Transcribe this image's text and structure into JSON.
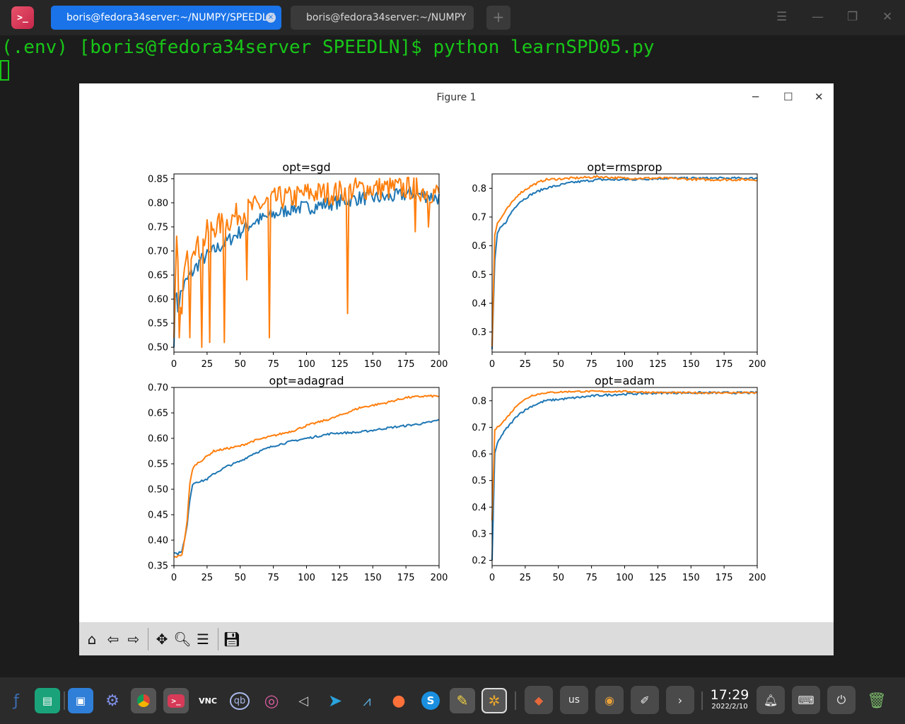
{
  "terminal": {
    "tabs": [
      {
        "label": "boris@fedora34server:~/NUMPY/SPEEDLN",
        "active": true
      },
      {
        "label": "boris@fedora34server:~/NUMPY",
        "active": false
      }
    ],
    "new_tab": "+",
    "command_line": "(.env) [boris@fedora34server SPEEDLN]$ python learnSPD05.py",
    "text_color": "#18c618"
  },
  "figure": {
    "title": "Figure 1",
    "toolbar": [
      "home-icon",
      "back-icon",
      "forward-icon",
      "pan-icon",
      "zoom-icon",
      "configure-icon",
      "save-icon"
    ]
  },
  "chart_data": [
    {
      "type": "line",
      "title": "opt=sgd",
      "xlim": [
        0,
        200
      ],
      "ylim": [
        0.49,
        0.86
      ],
      "xticks": [
        "0",
        "25",
        "50",
        "75",
        "100",
        "125",
        "150",
        "175",
        "200"
      ],
      "yticks": [
        "0.50",
        "0.55",
        "0.60",
        "0.65",
        "0.70",
        "0.75",
        "0.80",
        "0.85"
      ],
      "ytick_values": [
        0.5,
        0.55,
        0.6,
        0.65,
        0.7,
        0.75,
        0.8,
        0.85
      ],
      "series": [
        {
          "color": "#1f77b4",
          "noise": 0.015,
          "x": [
            0,
            1,
            3,
            5,
            8,
            10,
            15,
            20,
            25,
            30,
            40,
            50,
            60,
            70,
            80,
            90,
            100,
            120,
            140,
            160,
            180,
            200
          ],
          "values": [
            0.5,
            0.62,
            0.58,
            0.61,
            0.63,
            0.64,
            0.66,
            0.68,
            0.69,
            0.7,
            0.72,
            0.74,
            0.76,
            0.77,
            0.78,
            0.79,
            0.79,
            0.8,
            0.81,
            0.81,
            0.82,
            0.81
          ]
        },
        {
          "color": "#ff7f0e",
          "noise": 0.025,
          "x": [
            0,
            2,
            5,
            8,
            10,
            15,
            20,
            25,
            30,
            40,
            50,
            60,
            70,
            80,
            90,
            100,
            120,
            140,
            160,
            180,
            200
          ],
          "values": [
            0.52,
            0.71,
            0.56,
            0.66,
            0.68,
            0.72,
            0.7,
            0.74,
            0.75,
            0.76,
            0.78,
            0.79,
            0.8,
            0.81,
            0.81,
            0.82,
            0.82,
            0.83,
            0.83,
            0.83,
            0.82
          ],
          "dips": [
            [
              4,
              0.52
            ],
            [
              12,
              0.52
            ],
            [
              21,
              0.5
            ],
            [
              27,
              0.51
            ],
            [
              38,
              0.51
            ],
            [
              55,
              0.64
            ],
            [
              72,
              0.52
            ],
            [
              131,
              0.57
            ],
            [
              182,
              0.74
            ],
            [
              192,
              0.75
            ]
          ]
        }
      ]
    },
    {
      "type": "line",
      "title": "opt=rmsprop",
      "xlim": [
        0,
        200
      ],
      "ylim": [
        0.23,
        0.85
      ],
      "xticks": [
        "0",
        "25",
        "50",
        "75",
        "100",
        "125",
        "150",
        "175",
        "200"
      ],
      "yticks": [
        "0.3",
        "0.4",
        "0.5",
        "0.6",
        "0.7",
        "0.8"
      ],
      "ytick_values": [
        0.3,
        0.4,
        0.5,
        0.6,
        0.7,
        0.8
      ],
      "series": [
        {
          "color": "#1f77b4",
          "noise": 0.004,
          "x": [
            0,
            2,
            4,
            6,
            10,
            15,
            20,
            30,
            40,
            60,
            80,
            100,
            130,
            160,
            200
          ],
          "values": [
            0.24,
            0.55,
            0.64,
            0.66,
            0.68,
            0.72,
            0.75,
            0.78,
            0.8,
            0.82,
            0.83,
            0.83,
            0.835,
            0.835,
            0.835
          ]
        },
        {
          "color": "#ff7f0e",
          "noise": 0.004,
          "x": [
            0,
            2,
            4,
            6,
            10,
            15,
            20,
            30,
            40,
            60,
            80,
            100,
            130,
            160,
            200
          ],
          "values": [
            0.25,
            0.64,
            0.68,
            0.69,
            0.72,
            0.75,
            0.78,
            0.81,
            0.83,
            0.835,
            0.84,
            0.835,
            0.835,
            0.83,
            0.83
          ]
        }
      ]
    },
    {
      "type": "line",
      "title": "opt=adagrad",
      "xlim": [
        0,
        200
      ],
      "ylim": [
        0.35,
        0.7
      ],
      "xticks": [
        "0",
        "25",
        "50",
        "75",
        "100",
        "125",
        "150",
        "175",
        "200"
      ],
      "yticks": [
        "0.35",
        "0.40",
        "0.45",
        "0.50",
        "0.55",
        "0.60",
        "0.65",
        "0.70"
      ],
      "ytick_values": [
        0.35,
        0.4,
        0.45,
        0.5,
        0.55,
        0.6,
        0.65,
        0.7
      ],
      "series": [
        {
          "color": "#1f77b4",
          "noise": 0.002,
          "x": [
            0,
            3,
            6,
            8,
            10,
            12,
            14,
            17,
            20,
            25,
            30,
            40,
            50,
            60,
            75,
            90,
            100,
            120,
            140,
            160,
            175,
            190,
            200
          ],
          "values": [
            0.375,
            0.373,
            0.38,
            0.4,
            0.43,
            0.48,
            0.51,
            0.515,
            0.515,
            0.52,
            0.53,
            0.545,
            0.555,
            0.57,
            0.585,
            0.595,
            0.6,
            0.61,
            0.612,
            0.62,
            0.625,
            0.63,
            0.636
          ]
        },
        {
          "color": "#ff7f0e",
          "noise": 0.002,
          "x": [
            0,
            3,
            6,
            8,
            10,
            12,
            14,
            17,
            20,
            25,
            30,
            40,
            50,
            60,
            75,
            90,
            100,
            120,
            140,
            160,
            175,
            190,
            200
          ],
          "values": [
            0.367,
            0.368,
            0.372,
            0.4,
            0.44,
            0.51,
            0.54,
            0.55,
            0.555,
            0.565,
            0.575,
            0.58,
            0.585,
            0.595,
            0.605,
            0.615,
            0.625,
            0.64,
            0.66,
            0.67,
            0.68,
            0.683,
            0.683
          ]
        }
      ]
    },
    {
      "type": "line",
      "title": "opt=adam",
      "xlim": [
        0,
        200
      ],
      "ylim": [
        0.18,
        0.85
      ],
      "xticks": [
        "0",
        "25",
        "50",
        "75",
        "100",
        "125",
        "150",
        "175",
        "200"
      ],
      "yticks": [
        "0.2",
        "0.3",
        "0.4",
        "0.5",
        "0.6",
        "0.7",
        "0.8"
      ],
      "ytick_values": [
        0.2,
        0.3,
        0.4,
        0.5,
        0.6,
        0.7,
        0.8
      ],
      "series": [
        {
          "color": "#1f77b4",
          "noise": 0.004,
          "x": [
            0,
            2,
            4,
            6,
            10,
            15,
            20,
            30,
            40,
            60,
            80,
            100,
            130,
            160,
            200
          ],
          "values": [
            0.2,
            0.6,
            0.64,
            0.66,
            0.69,
            0.72,
            0.75,
            0.78,
            0.8,
            0.81,
            0.82,
            0.825,
            0.83,
            0.83,
            0.83
          ]
        },
        {
          "color": "#ff7f0e",
          "noise": 0.003,
          "x": [
            0,
            2,
            4,
            6,
            10,
            15,
            20,
            30,
            40,
            60,
            80,
            100,
            130,
            160,
            200
          ],
          "values": [
            0.35,
            0.69,
            0.7,
            0.71,
            0.73,
            0.76,
            0.79,
            0.82,
            0.83,
            0.835,
            0.835,
            0.835,
            0.83,
            0.83,
            0.83
          ]
        }
      ]
    }
  ],
  "taskbar": {
    "icons": [
      "fedora-icon",
      "files-icon",
      "archive-icon",
      "settings-icon",
      "chrome-icon",
      "terminal-icon",
      "vnc-icon",
      "qbittorrent-icon",
      "disc-icon",
      "volume-icon",
      "telegram-icon",
      "monitor-icon",
      "firefox-icon",
      "skype-icon",
      "notes-icon",
      "inkscape-icon",
      "package-icon",
      "keyboard-layout",
      "unknown-app-icon",
      "pen-icon",
      "expand-icon",
      "notification-icon",
      "keyboard-icon",
      "power-icon",
      "trash-icon"
    ],
    "keyboard_layout": "us",
    "time": "17:29",
    "date": "2022/2/10"
  }
}
